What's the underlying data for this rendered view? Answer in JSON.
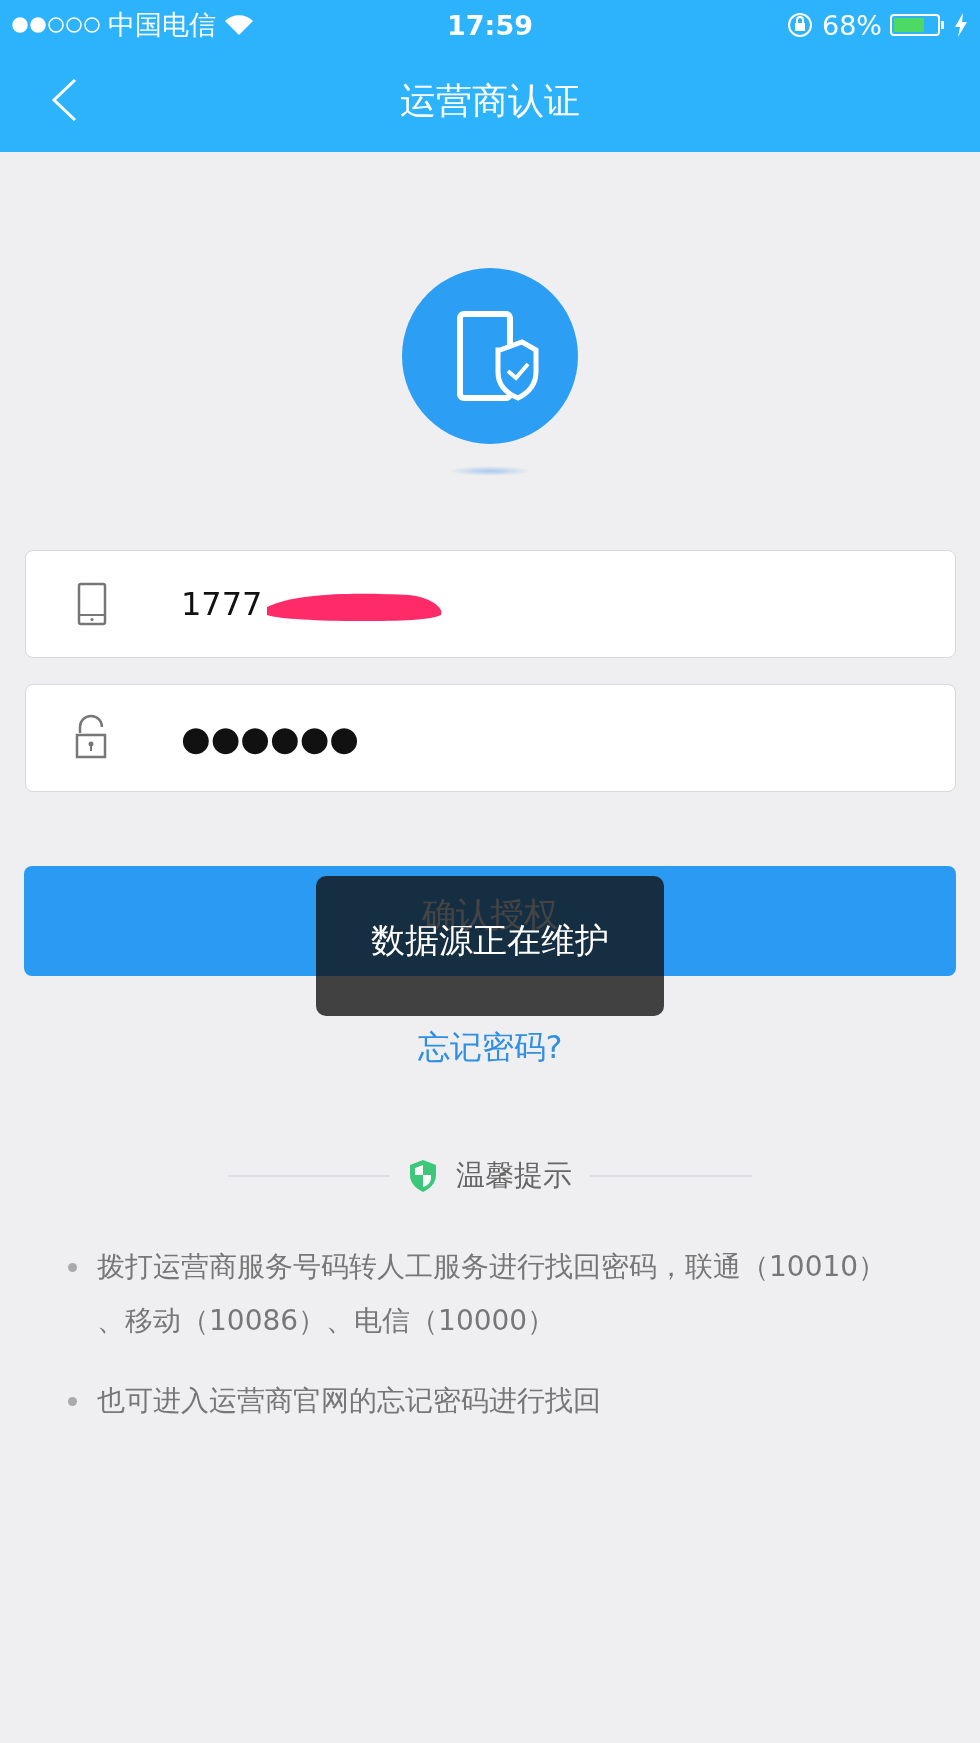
{
  "status_bar": {
    "carrier": "中国电信",
    "time": "17:59",
    "battery": "68%"
  },
  "nav": {
    "title": "运营商认证"
  },
  "form": {
    "phone": {
      "value": "1777"
    },
    "password": {
      "value": "●●●●●●"
    }
  },
  "confirm_button": {
    "label": "确认授权"
  },
  "toast": {
    "message": "数据源正在维护"
  },
  "forgot_link": "忘记密码?",
  "tips": {
    "title": "温馨提示",
    "items": [
      "拨打运营商服务号码转人工服务进行找回密码，联通（10010）、移动（10086）、电信（10000）",
      "也可进入运营商官网的忘记密码进行找回"
    ]
  }
}
